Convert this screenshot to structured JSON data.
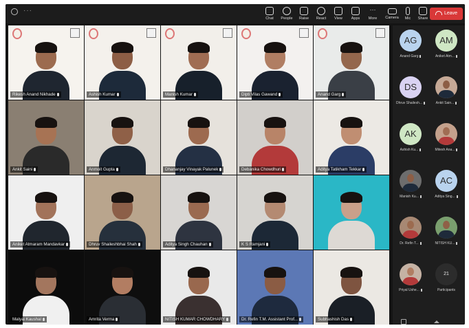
{
  "toolbar": {
    "buttons": [
      {
        "label": "Chat",
        "icon": "chat-icon"
      },
      {
        "label": "People",
        "icon": "people-icon"
      },
      {
        "label": "Raise",
        "icon": "raise-hand-icon"
      },
      {
        "label": "React",
        "icon": "react-icon"
      },
      {
        "label": "View",
        "icon": "view-icon"
      },
      {
        "label": "Apps",
        "icon": "apps-icon"
      },
      {
        "label": "More",
        "icon": "more-icon"
      },
      {
        "label": "Camera",
        "icon": "camera-icon"
      },
      {
        "label": "Mic",
        "icon": "mic-icon"
      },
      {
        "label": "Share",
        "icon": "share-icon"
      }
    ],
    "leave_label": "Leave",
    "leave_color": "#d93838"
  },
  "tiles": [
    {
      "name": "Rikesh Anand Nikhade"
    },
    {
      "name": "Ashish Kumar"
    },
    {
      "name": "Manish Kumar"
    },
    {
      "name": "Dipti Vilas Gawand"
    },
    {
      "name": "Anand Garg"
    },
    {
      "name": "Ankit Saini"
    },
    {
      "name": "Anmoit Gupta"
    },
    {
      "name": "Dhananjay Vinayak Palunek"
    },
    {
      "name": "Debanika Chowdhuri"
    },
    {
      "name": "Aditya Tatikham Tekkar"
    },
    {
      "name": "Aniket Atmaram Mandavkar"
    },
    {
      "name": "Dhruv Shaileshbhai Shah"
    },
    {
      "name": "Aditya Singh Chauhan"
    },
    {
      "name": "K S Ramjani"
    },
    {
      "name": ""
    },
    {
      "name": "Malyai Kaushal"
    },
    {
      "name": "Amrita Verma"
    },
    {
      "name": "NITISH KUMAR CHOWDHARY"
    },
    {
      "name": "Dr. Refin T.M. Assistant Prof..."
    },
    {
      "name": "Subhashish Das"
    }
  ],
  "participants": [
    {
      "initials": "AG",
      "name": "Anand Garg"
    },
    {
      "initials": "AM",
      "name": "Aniket Atm..."
    },
    {
      "initials": "DS",
      "name": "Dhruv Shailesh..."
    },
    {
      "initials": "",
      "name": "Ankit Sain..."
    },
    {
      "initials": "AK",
      "name": "Ashish Ku..."
    },
    {
      "initials": "",
      "name": "Mitesh Ana..."
    },
    {
      "initials": "",
      "name": "Manish Ku..."
    },
    {
      "initials": "AC",
      "name": "Aditya Sing..."
    },
    {
      "initials": "",
      "name": "Dr. Refin T..."
    },
    {
      "initials": "",
      "name": "NITISH KU..."
    },
    {
      "initials": "",
      "name": "Priyal Ushe..."
    },
    {
      "initials": "",
      "name": "Participants",
      "count": "21"
    }
  ]
}
